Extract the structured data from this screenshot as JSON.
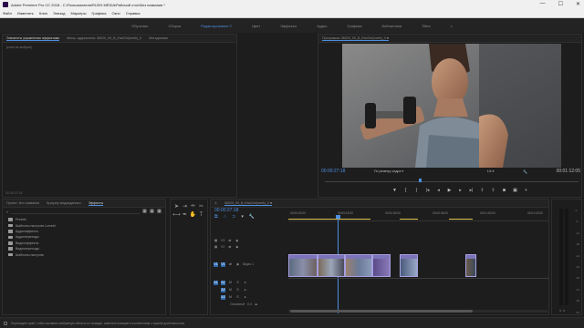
{
  "window": {
    "title": "Adobe Premiere Pro CC 2018 - C:\\Пользователи\\RUSH MEDIA\\Рабочий стол\\Без названия *",
    "controls": [
      "—",
      "☐",
      "✕"
    ]
  },
  "menu": [
    "Файл",
    "Изменить",
    "Клип",
    "Эпизод",
    "Маркеры",
    "Графика",
    "Окно",
    "Справка"
  ],
  "workspaces": {
    "items": [
      "Обучение",
      "Сборка",
      "Редактирование",
      "Цвет",
      "Эффекты",
      "Аудио",
      "Графика",
      "Библиотеки",
      "Titles"
    ],
    "active_index": 2,
    "more": "»"
  },
  "source_panel": {
    "tabs": [
      "Элементы управления эффектами",
      "Микш. аудиоклипа: 56020_09_B_KiwiGirl(meth)_0",
      "Метаданные"
    ],
    "active_tab": 0,
    "hint": "(клип не выбран)",
    "timecode": "00:00:27:18"
  },
  "program_monitor": {
    "tab": "Программа: 56020_09_B_KiwiGirl(meth)_0",
    "timecode": "00:00:27:18",
    "fit": "По размеру кадра",
    "resolution": "1/4",
    "duration": "00:01:12:05"
  },
  "project_panel": {
    "tabs": [
      "Проект: Без названия",
      "Браузер медиаданных",
      "Эффекты"
    ],
    "active_tab": 2,
    "folders": [
      "Presets",
      "Шаблоны настроек Lumetri",
      "Аудиоэффекты",
      "Аудиопереходы",
      "Видеоэффекты",
      "Видеопереходы",
      "Шаблоны настроек"
    ]
  },
  "timeline": {
    "tab": "56020_09_B_KiwiGirl(meth)_0",
    "timecode": "00:00:27:18",
    "ruler": [
      "00:00:00:00",
      "00:00:15:00",
      "00:00:30:00",
      "00:00:45:00",
      "00:01:00:00",
      "00:01:15:00"
    ],
    "video_tracks": [
      "V3",
      "V2",
      "V1"
    ],
    "video_label": "Видео 1",
    "audio_tracks": [
      "A1",
      "A2",
      "A3"
    ],
    "master": "Основной",
    "master_value": "0,0"
  },
  "meters": {
    "scale": [
      "0",
      "-6",
      "-12",
      "-18",
      "-24",
      "-30",
      "-36",
      "-42",
      "-48",
      "-54"
    ],
    "solo": [
      "S",
      "S"
    ]
  },
  "status": "Перетащите край, чтобы заставить выбранную область по позиции, изменить позицию в соответствии с нужной длительностью."
}
